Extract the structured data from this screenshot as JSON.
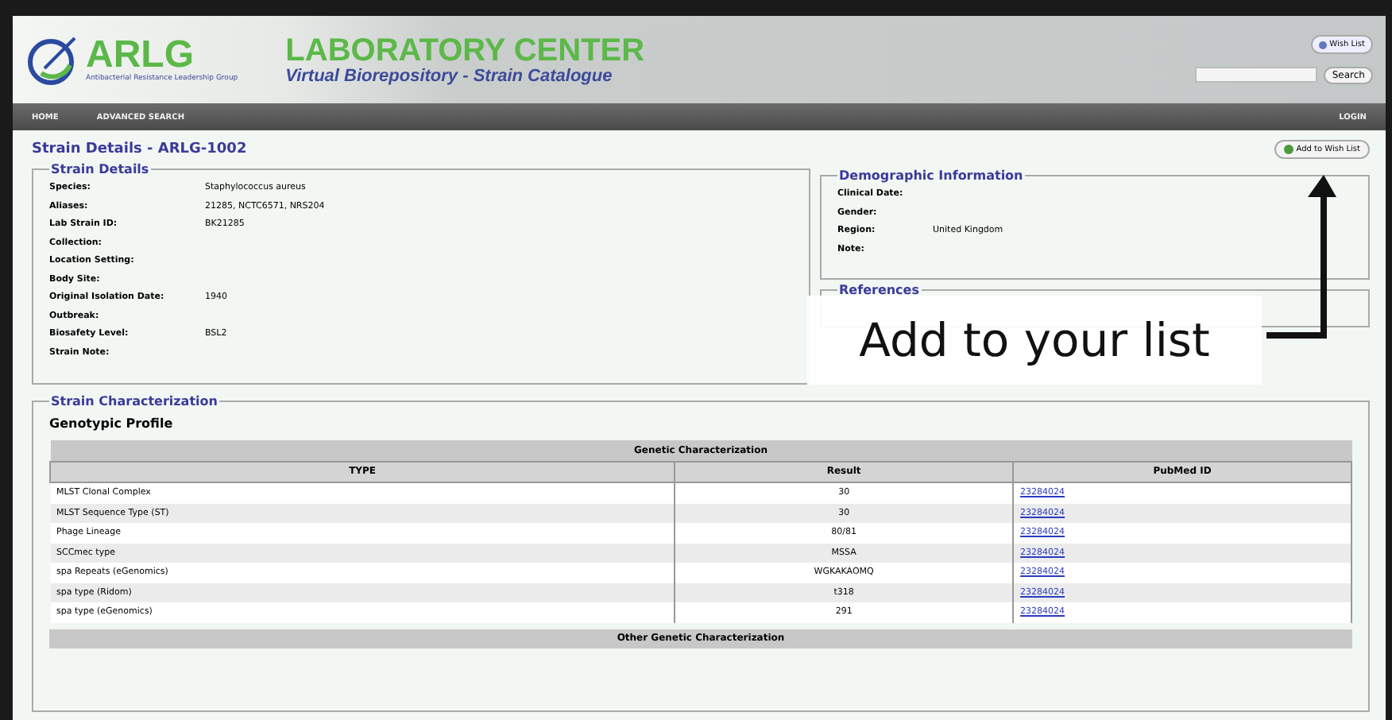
{
  "header": {
    "logo": "ARLG",
    "tagline": "Antibacterial Resistance Leadership Group",
    "title": "LABORATORY CENTER",
    "subtitle": "Virtual Biorepository - Strain Catalogue",
    "wish_list_button": "Wish List",
    "search_button": "Search"
  },
  "nav": {
    "items": [
      {
        "label": "HOME"
      },
      {
        "label": "ADVANCED SEARCH"
      }
    ],
    "login": "LOGIN"
  },
  "page_title": "Strain Details - ARLG-1002",
  "add_button": "Add to Wish List",
  "strain_details": {
    "legend": "Strain Details",
    "fields": [
      {
        "label": "Species:",
        "value": "Staphylococcus aureus"
      },
      {
        "label": "Aliases:",
        "value": "21285, NCTC6571, NRS204"
      },
      {
        "label": "Lab Strain ID:",
        "value": "BK21285"
      },
      {
        "label": "Collection:"
      },
      {
        "label": "Location Setting:"
      },
      {
        "label": "Body Site:"
      },
      {
        "label": "Original Isolation Date:",
        "value": "1940"
      },
      {
        "label": "Outbreak:"
      },
      {
        "label": "Biosafety Level:",
        "value": "BSL2"
      },
      {
        "label": "Strain Note:"
      }
    ]
  },
  "demographic": {
    "legend": "Demographic Information",
    "fields": [
      {
        "label": "Clinical Date:"
      },
      {
        "label": "Gender:"
      },
      {
        "label": "Region:",
        "value": "United Kingdom"
      },
      {
        "label": "Note:"
      }
    ]
  },
  "references": {
    "legend": "References"
  },
  "characterization": {
    "legend": "Strain Characterization",
    "heading": "Genotypic Profile",
    "table": {
      "title": "Genetic Characterization",
      "columns": [
        "TYPE",
        "Result",
        "PubMed ID"
      ],
      "rows": [
        [
          "MLST Clonal Complex",
          "30",
          "23284024"
        ],
        [
          "MLST Sequence Type (ST)",
          "30",
          "23284024"
        ],
        [
          "Phage Lineage",
          "80/81",
          "23284024"
        ],
        [
          "SCCmec type",
          "MSSA",
          "23284024"
        ],
        [
          "spa Repeats (eGenomics)",
          "WGKAKAOMQ",
          "23284024"
        ],
        [
          "spa type (Ridom)",
          "t318",
          "23284024"
        ],
        [
          "spa type (eGenomics)",
          "291",
          "23284024"
        ]
      ]
    },
    "next_table_title": "Other Genetic Characterization"
  },
  "annotation": {
    "text": "Add to your list"
  }
}
